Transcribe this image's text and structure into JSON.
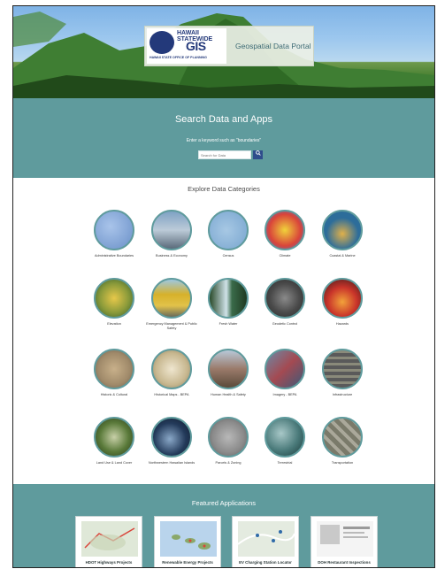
{
  "header": {
    "logo_title": "HAWAII STATEWIDE",
    "logo_gis": "GIS",
    "logo_sub": "HAWAII STATE OFFICE OF PLANNING",
    "portal_title": "Geospatial Data Portal"
  },
  "search": {
    "title": "Search Data and Apps",
    "hint": "Enter a keyword such as \"boundaries\"",
    "placeholder": "Search for Data",
    "button_icon": "search-icon"
  },
  "categories": {
    "heading": "Explore Data Categories",
    "items": [
      {
        "label": "Administrative Boundaries",
        "color": "#6a90c8"
      },
      {
        "label": "Business & Economy",
        "color": "#7fa2c4"
      },
      {
        "label": "Census",
        "color": "#78a5cf"
      },
      {
        "label": "Climate",
        "color": "#d9443a"
      },
      {
        "label": "Coastal & Marine",
        "color": "#2d6d9a"
      },
      {
        "label": "Elevation",
        "color": "#8a9a3a"
      },
      {
        "label": "Emergency Management & Public Safety",
        "color": "#d6b12a"
      },
      {
        "label": "Fresh Water",
        "color": "#3a6b4a"
      },
      {
        "label": "Geodetic Control",
        "color": "#4a4a4a"
      },
      {
        "label": "Hazards",
        "color": "#c9342a"
      },
      {
        "label": "Historic & Cultural",
        "color": "#a08a6a"
      },
      {
        "label": "Historical Maps - BEPA",
        "color": "#c7b78f"
      },
      {
        "label": "Human Health & Safety",
        "color": "#9a7a6a"
      },
      {
        "label": "Imagery - BEPA",
        "color": "#a44a52"
      },
      {
        "label": "Infrastructure",
        "color": "#5a5a5a"
      },
      {
        "label": "Land Use & Land Cover",
        "color": "#5a7a3a"
      },
      {
        "label": "Northwestern Hawaiian Islands",
        "color": "#233a5a"
      },
      {
        "label": "Parcels & Zoning",
        "color": "#8a8a8a"
      },
      {
        "label": "Terrestrial",
        "color": "#4a7a7a"
      },
      {
        "label": "Transportation",
        "color": "#7a7a6a"
      }
    ]
  },
  "featured": {
    "heading": "Featured Applications",
    "apps": [
      {
        "label": "HDOT Highways Projects"
      },
      {
        "label": "Renewable Energy Projects"
      },
      {
        "label": "EV Charging Station Locator"
      },
      {
        "label": "DOH Restaurant Inspections"
      }
    ]
  }
}
